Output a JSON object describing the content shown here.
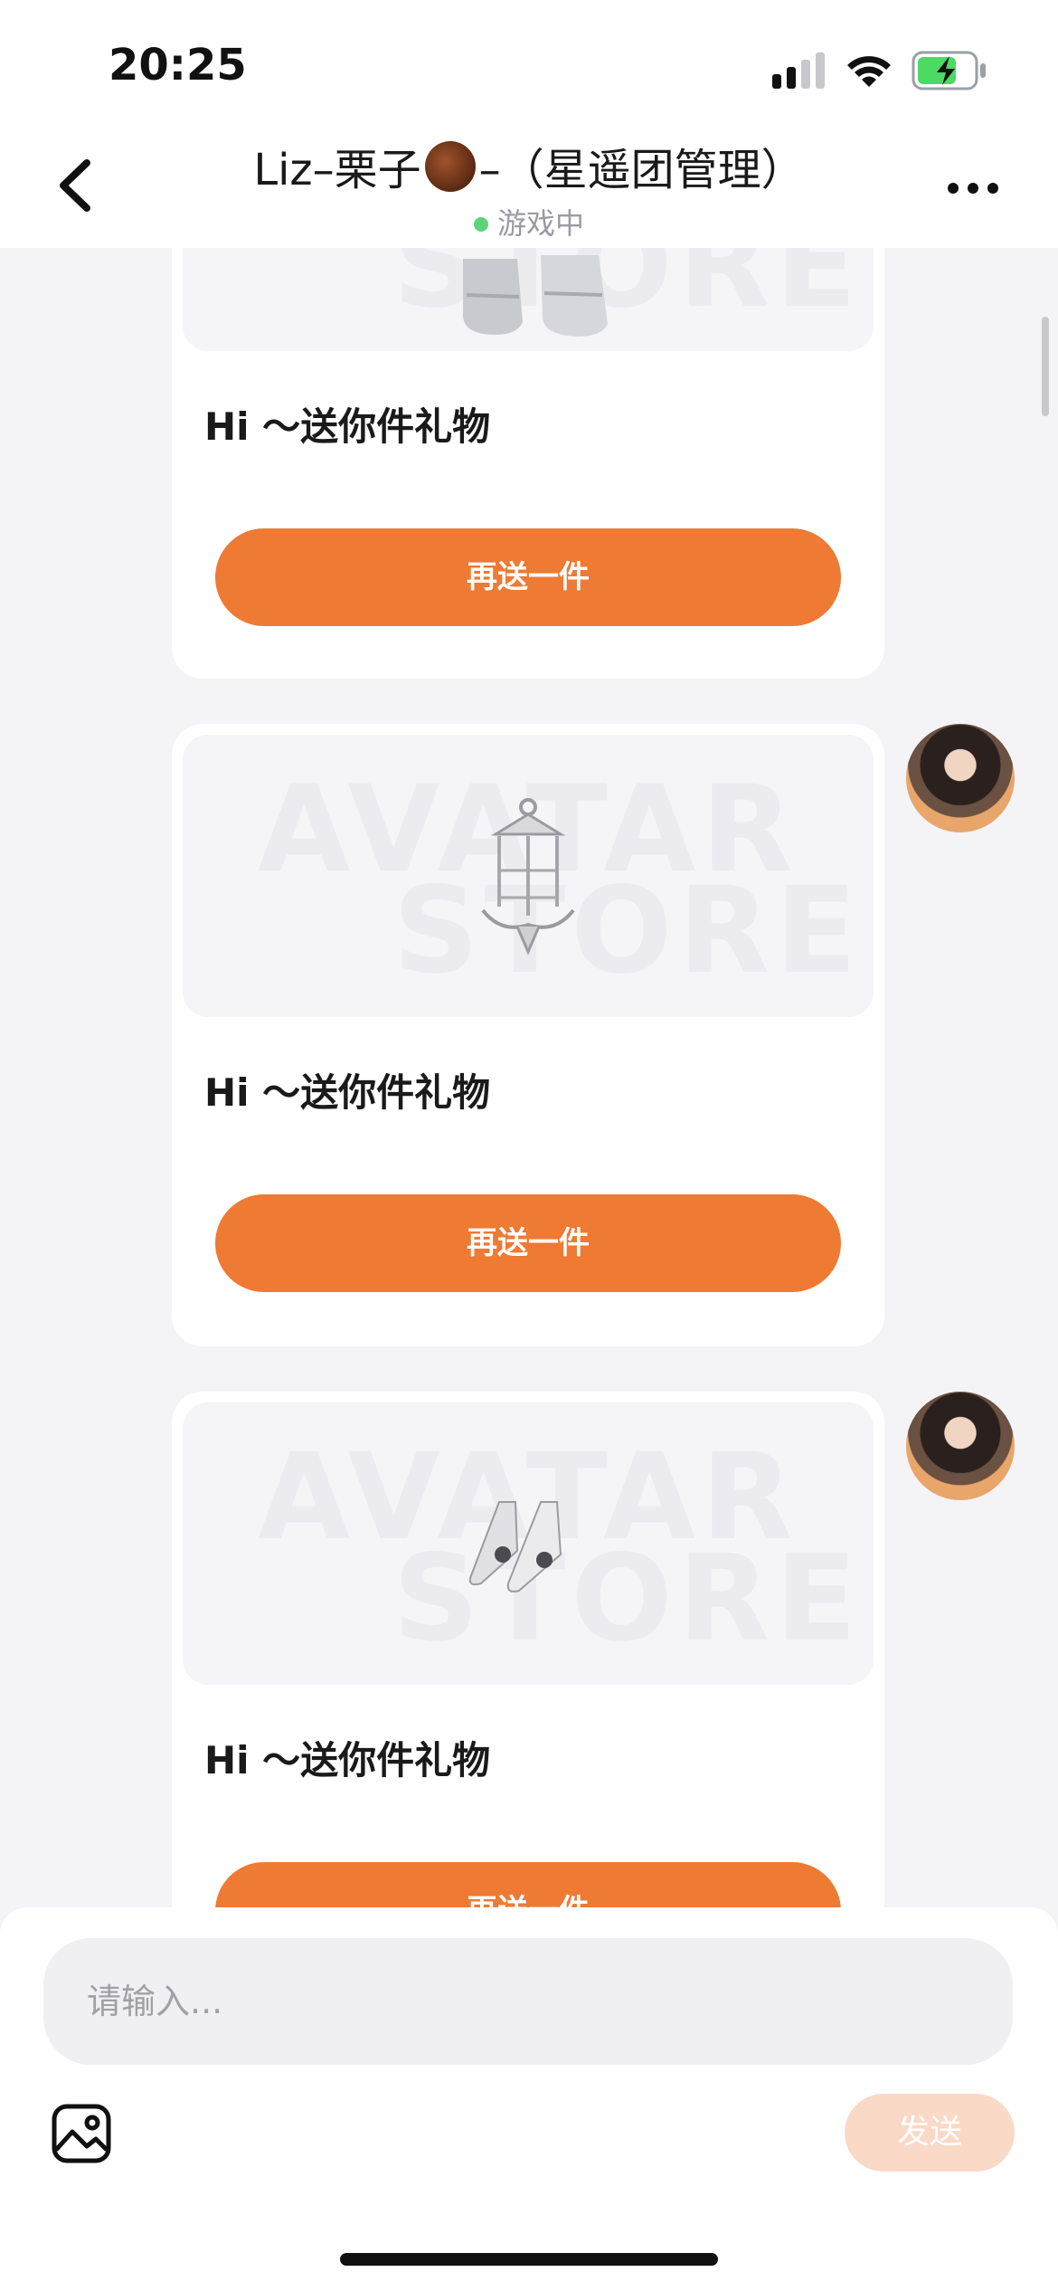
{
  "status_bar": {
    "time": "20:25",
    "signal_icon": "signal-bars-icon",
    "wifi_icon": "wifi-icon",
    "battery_icon": "battery-charging-icon",
    "battery_color": "#4cd964"
  },
  "header": {
    "title_prefix": "Liz–栗子",
    "title_suffix": "–（星遥团管理）",
    "status": "游戏中",
    "back_icon": "chevron-left-icon",
    "more_icon": "more-dots-icon"
  },
  "messages": [
    {
      "text": "Hi ～送你件礼物",
      "button": "再送一件",
      "item_icon": "sneakers-icon"
    },
    {
      "text": "Hi ～送你件礼物",
      "button": "再送一件",
      "item_icon": "lantern-icon"
    },
    {
      "text": "Hi ～送你件礼物",
      "button": "再送一件",
      "item_icon": "heels-icon"
    }
  ],
  "watermark": {
    "line1": "AVATAR",
    "line2": "STORE"
  },
  "composer": {
    "placeholder": "请输入...",
    "send_label": "发送",
    "image_icon": "image-icon"
  },
  "colors": {
    "accent": "#ee7a33",
    "send_disabled": "#fbd9c7",
    "online": "#5fd37b"
  }
}
